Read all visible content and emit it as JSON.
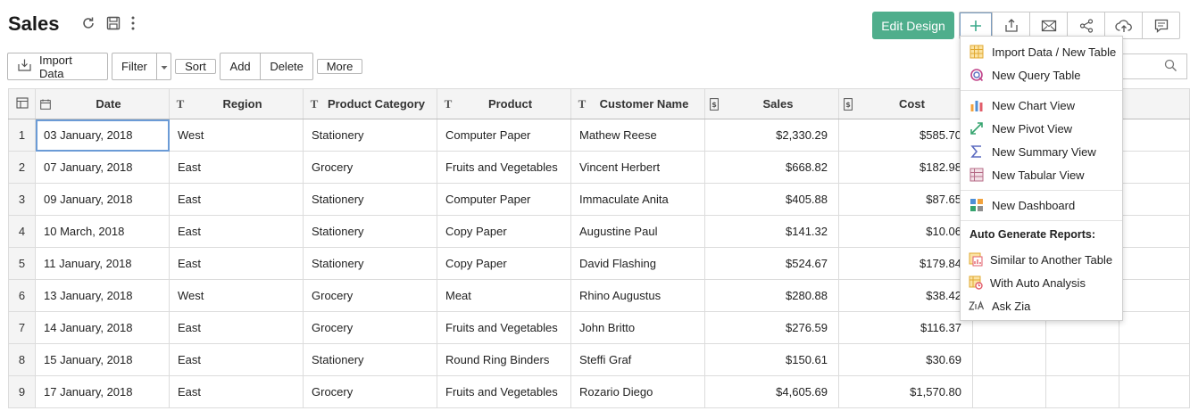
{
  "header": {
    "title": "Sales"
  },
  "actions": {
    "edit_design_label": "Edit Design"
  },
  "toolbar": {
    "import_label": "Import Data",
    "filter_label": "Filter",
    "sort_label": "Sort",
    "add_label": "Add",
    "delete_label": "Delete",
    "more_label": "More"
  },
  "table": {
    "columns": [
      {
        "label": "Date",
        "type_icon": "calendar-icon"
      },
      {
        "label": "Region",
        "type_icon": "text-type-icon"
      },
      {
        "label": "Product Category",
        "type_icon": "text-type-icon"
      },
      {
        "label": "Product",
        "type_icon": "text-type-icon"
      },
      {
        "label": "Customer Name",
        "type_icon": "text-type-icon"
      },
      {
        "label": "Sales",
        "type_icon": "currency-icon"
      },
      {
        "label": "Cost",
        "type_icon": "currency-icon"
      }
    ],
    "rows": [
      {
        "num": "1",
        "date": "03 January, 2018",
        "region": "West",
        "category": "Stationery",
        "product": "Computer Paper",
        "customer": "Mathew Reese",
        "sales": "$2,330.29",
        "cost": "$585.70"
      },
      {
        "num": "2",
        "date": "07 January, 2018",
        "region": "East",
        "category": "Grocery",
        "product": "Fruits and Vegetables",
        "customer": "Vincent Herbert",
        "sales": "$668.82",
        "cost": "$182.98"
      },
      {
        "num": "3",
        "date": "09 January, 2018",
        "region": "East",
        "category": "Stationery",
        "product": "Computer Paper",
        "customer": "Immaculate Anita",
        "sales": "$405.88",
        "cost": "$87.65"
      },
      {
        "num": "4",
        "date": "10 March, 2018",
        "region": "East",
        "category": "Stationery",
        "product": "Copy Paper",
        "customer": "Augustine Paul",
        "sales": "$141.32",
        "cost": "$10.06"
      },
      {
        "num": "5",
        "date": "11 January, 2018",
        "region": "East",
        "category": "Stationery",
        "product": "Copy Paper",
        "customer": "David Flashing",
        "sales": "$524.67",
        "cost": "$179.84"
      },
      {
        "num": "6",
        "date": "13 January, 2018",
        "region": "West",
        "category": "Grocery",
        "product": "Meat",
        "customer": "Rhino Augustus",
        "sales": "$280.88",
        "cost": "$38.42"
      },
      {
        "num": "7",
        "date": "14 January, 2018",
        "region": "East",
        "category": "Grocery",
        "product": "Fruits and Vegetables",
        "customer": "John Britto",
        "sales": "$276.59",
        "cost": "$116.37"
      },
      {
        "num": "8",
        "date": "15 January, 2018",
        "region": "East",
        "category": "Stationery",
        "product": "Round Ring Binders",
        "customer": "Steffi Graf",
        "sales": "$150.61",
        "cost": "$30.69"
      },
      {
        "num": "9",
        "date": "17 January, 2018",
        "region": "East",
        "category": "Grocery",
        "product": "Fruits and Vegetables",
        "customer": "Rozario Diego",
        "sales": "$4,605.69",
        "cost": "$1,570.80"
      }
    ]
  },
  "menu": {
    "import": "Import Data / New Table",
    "query": "New Query Table",
    "chart": "New Chart View",
    "pivot": "New Pivot View",
    "summary": "New Summary View",
    "tabular": "New Tabular View",
    "dashboard": "New Dashboard",
    "auto_header": "Auto Generate Reports:",
    "similar": "Similar to Another Table",
    "auto_analysis": "With Auto Analysis",
    "zia": "Ask Zia"
  },
  "colors": {
    "accent": "#4fae8c",
    "selection": "#6b9bd6"
  }
}
